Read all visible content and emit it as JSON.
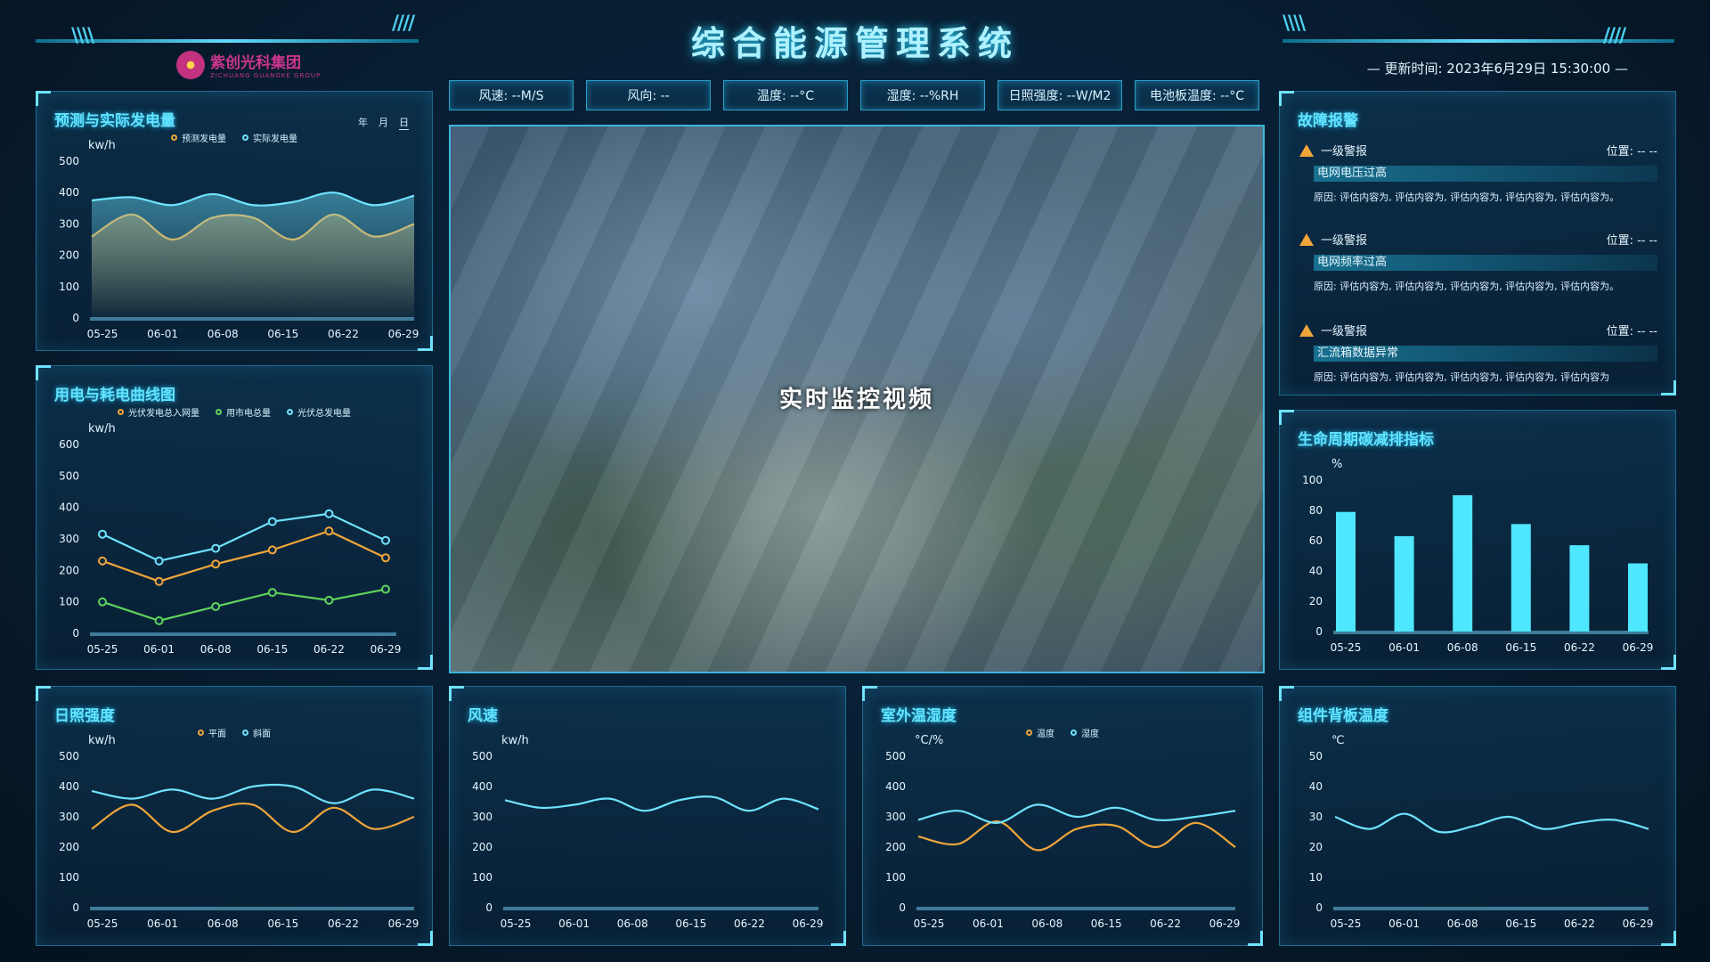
{
  "header": {
    "title": "综合能源管理系统",
    "logo_name": "紫创光科集团",
    "logo_sub": "ZICHUANG GUANGKE GROUP",
    "update_time": "—  更新时间: 2023年6月29日 15:30:00  —"
  },
  "metrics": [
    "风速: --M/S",
    "风向: --",
    "温度: --°C",
    "湿度: --%RH",
    "日照强度: --W/M2",
    "电池板温度: --°C"
  ],
  "video": {
    "label": "实时监控视频"
  },
  "panels": {
    "forecast": {
      "title": "预测与实际发电量",
      "period": [
        "年",
        "月",
        "日"
      ],
      "active_period": "日"
    },
    "usage": {
      "title": "用电与耗电曲线图"
    },
    "sunlight": {
      "title": "日照强度"
    },
    "wind": {
      "title": "风速"
    },
    "outdoor": {
      "title": "室外温湿度"
    },
    "backplate": {
      "title": "组件背板温度"
    },
    "carbon": {
      "title": "生命周期碳减排指标"
    },
    "fault": {
      "title": "故障报警"
    }
  },
  "faults": [
    {
      "level": "一级警报",
      "location": "位置: -- --",
      "name": "电网电压过高",
      "reason": "原因: 评估内容为, 评估内容为, 评估内容为, 评估内容为, 评估内容为。"
    },
    {
      "level": "一级警报",
      "location": "位置: -- --",
      "name": "电网频率过高",
      "reason": "原因: 评估内容为, 评估内容为, 评估内容为, 评估内容为, 评估内容为。"
    },
    {
      "level": "一级警报",
      "location": "位置: -- --",
      "name": "汇流箱数据异常",
      "reason": "原因: 评估内容为, 评估内容为, 评估内容为, 评估内容为, 评估内容为"
    }
  ],
  "colors": {
    "cyan": "#6fe3ff",
    "orange": "#f0a53a",
    "green": "#5fd35a",
    "bar": "#4fe6ff"
  },
  "chart_data": [
    {
      "id": "forecast",
      "type": "area",
      "categories": [
        "05-25",
        "06-01",
        "06-08",
        "06-15",
        "06-22",
        "06-29"
      ],
      "ylabel": "kw/h",
      "ylim": [
        0,
        500
      ],
      "yticks": [
        0,
        100,
        200,
        300,
        400,
        500
      ],
      "series": [
        {
          "name": "预测发电量",
          "color": "#f0a53a",
          "values": [
            260,
            330,
            250,
            320,
            320,
            250,
            330,
            260,
            300
          ]
        },
        {
          "name": "实际发电量",
          "color": "#6fe3ff",
          "values": [
            375,
            385,
            360,
            395,
            360,
            370,
            400,
            360,
            390
          ]
        }
      ]
    },
    {
      "id": "usage",
      "type": "line",
      "categories": [
        "05-25",
        "06-01",
        "06-08",
        "06-15",
        "06-22",
        "06-29"
      ],
      "ylabel": "kw/h",
      "ylim": [
        0,
        600
      ],
      "yticks": [
        0,
        100,
        200,
        300,
        400,
        500,
        600
      ],
      "series": [
        {
          "name": "光伏发电总入网量",
          "color": "#f0a53a",
          "values": [
            230,
            165,
            220,
            265,
            325,
            240
          ]
        },
        {
          "name": "用市电总量",
          "color": "#5fd35a",
          "values": [
            100,
            40,
            85,
            130,
            105,
            140
          ]
        },
        {
          "name": "光伏总发电量",
          "color": "#6fe3ff",
          "values": [
            315,
            230,
            270,
            355,
            380,
            295
          ]
        }
      ]
    },
    {
      "id": "sunlight",
      "type": "line",
      "categories": [
        "05-25",
        "06-01",
        "06-08",
        "06-15",
        "06-22",
        "06-29"
      ],
      "ylabel": "kw/h",
      "ylim": [
        0,
        500
      ],
      "yticks": [
        0,
        100,
        200,
        300,
        400,
        500
      ],
      "series": [
        {
          "name": "平面",
          "color": "#f0a53a",
          "values": [
            260,
            340,
            250,
            320,
            340,
            250,
            330,
            260,
            300
          ]
        },
        {
          "name": "斜面",
          "color": "#6fe3ff",
          "values": [
            385,
            360,
            390,
            360,
            400,
            400,
            345,
            390,
            360
          ]
        }
      ]
    },
    {
      "id": "wind",
      "type": "line",
      "categories": [
        "05-25",
        "06-01",
        "06-08",
        "06-15",
        "06-22",
        "06-29"
      ],
      "ylabel": "kw/h",
      "ylim": [
        0,
        500
      ],
      "yticks": [
        0,
        100,
        200,
        300,
        400,
        500
      ],
      "series": [
        {
          "name": "",
          "color": "#6fe3ff",
          "values": [
            355,
            330,
            340,
            360,
            320,
            355,
            365,
            320,
            360,
            325
          ]
        }
      ]
    },
    {
      "id": "outdoor",
      "type": "line",
      "categories": [
        "05-25",
        "06-01",
        "06-08",
        "06-15",
        "06-22",
        "06-29"
      ],
      "ylabel": "°C/%",
      "ylim": [
        0,
        500
      ],
      "yticks": [
        0,
        100,
        200,
        300,
        400,
        500
      ],
      "series": [
        {
          "name": "温度",
          "color": "#f0a53a",
          "values": [
            235,
            210,
            285,
            190,
            260,
            270,
            200,
            280,
            200
          ]
        },
        {
          "name": "湿度",
          "color": "#6fe3ff",
          "values": [
            290,
            320,
            280,
            340,
            300,
            330,
            290,
            300,
            320
          ]
        }
      ]
    },
    {
      "id": "backplate",
      "type": "line",
      "categories": [
        "05-25",
        "06-01",
        "06-08",
        "06-15",
        "06-22",
        "06-29"
      ],
      "ylabel": "℃",
      "ylim": [
        0,
        50
      ],
      "yticks": [
        0,
        10,
        20,
        30,
        40,
        50
      ],
      "series": [
        {
          "name": "",
          "color": "#6fe3ff",
          "values": [
            30,
            26,
            31,
            25,
            27,
            30,
            26,
            28,
            29,
            26
          ]
        }
      ]
    },
    {
      "id": "carbon",
      "type": "bar",
      "categories": [
        "05-25",
        "06-01",
        "06-08",
        "06-15",
        "06-22",
        "06-29"
      ],
      "ylabel": "%",
      "ylim": [
        0,
        100
      ],
      "yticks": [
        0,
        20,
        40,
        60,
        80,
        100
      ],
      "values": [
        79,
        63,
        90,
        71,
        57,
        45
      ]
    }
  ]
}
